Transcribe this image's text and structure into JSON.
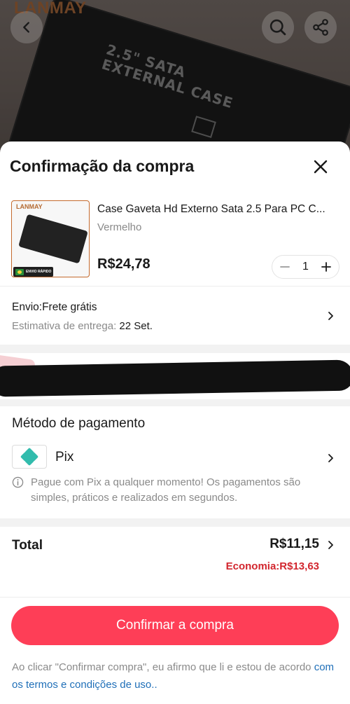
{
  "background": {
    "brand_logo": "LANMAY",
    "case_text_line1": "2.5\" SATA",
    "case_text_line2": "EXTERNAL CASE",
    "icons": [
      "back-arrow-icon",
      "search-icon",
      "share-icon"
    ]
  },
  "sheet": {
    "title": "Confirmação da compra",
    "close_icon": "close-icon"
  },
  "product": {
    "name": "Case Gaveta Hd Externo Sata 2.5 Para PC C...",
    "variant": "Vermelho",
    "price": "R$24,78",
    "quantity": "1",
    "thumb_logo": "LANMAY",
    "badge_text": "ENVIO RÁPIDO"
  },
  "shipping": {
    "title": "Envio:Frete grátis",
    "estimate_label": "Estimativa de entrega: ",
    "estimate_date": "22 Set."
  },
  "payment": {
    "title": "Método de pagamento",
    "method": "Pix",
    "info": "Pague com Pix a qualquer momento! Os pagamentos são simples, práticos e realizados em segundos."
  },
  "total": {
    "label": "Total",
    "value": "R$11,15",
    "savings": "Economia:R$13,63"
  },
  "confirm": {
    "label": "Confirmar a compra"
  },
  "terms": {
    "text": "Ao clicar \"Confirmar compra\", eu afirmo que li e estou de acordo ",
    "link": "com os termos e condições de uso.."
  },
  "colors": {
    "accent": "#fe3e57",
    "savings": "#d2262e",
    "link": "#1f6fb8",
    "pix": "#32bcad"
  }
}
